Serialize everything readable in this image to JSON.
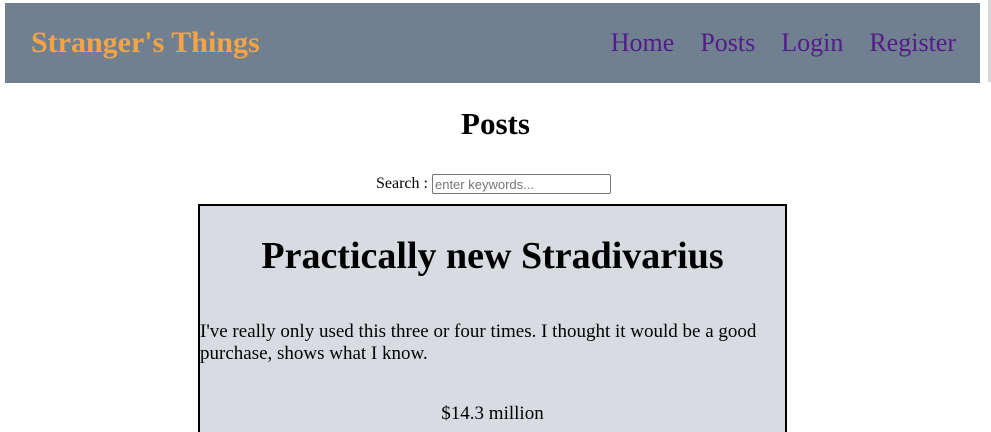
{
  "header": {
    "brand": "Stranger's Things",
    "nav": {
      "home": "Home",
      "posts": "Posts",
      "login": "Login",
      "register": "Register"
    }
  },
  "main": {
    "title": "Posts",
    "search": {
      "label": "Search :",
      "placeholder": "enter keywords...",
      "value": ""
    },
    "posts": [
      {
        "title": "Practically new Stradivarius",
        "description": "I've really only used this three or four times. I thought it would be a good purchase, shows what I know.",
        "price": "$14.3 million"
      }
    ]
  },
  "colors": {
    "header_bg": "#708090",
    "brand": "#f4a444",
    "nav_link": "#551a8b",
    "card_bg": "#d8dbe0"
  }
}
